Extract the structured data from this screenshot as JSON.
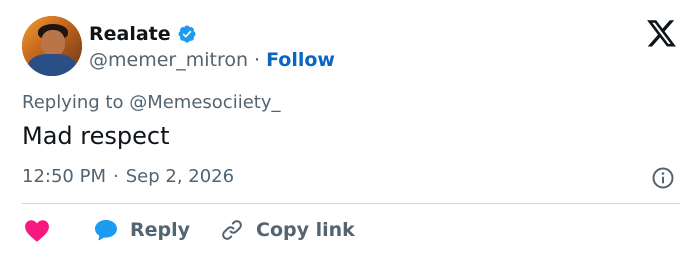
{
  "author": {
    "display_name": "Realate",
    "handle": "@memer_mitron",
    "separator": "·",
    "follow_label": "Follow"
  },
  "reply_context": {
    "prefix": "Replying to ",
    "mention": "@Memesociiety_"
  },
  "tweet": {
    "text": "Mad respect",
    "time": "12:50 PM",
    "separator": "·",
    "date": "Sep 2, 2026"
  },
  "actions": {
    "reply_label": "Reply",
    "copy_link_label": "Copy link"
  },
  "icons": {
    "verified": "verified-badge-icon",
    "x_logo": "x-logo-icon",
    "info": "info-icon",
    "like": "heart-icon",
    "reply": "speech-bubble-icon",
    "copy": "link-icon"
  },
  "colors": {
    "link_blue": "#0a66c2",
    "verified_blue": "#1d9bf0",
    "heart_pink": "#f91880",
    "muted_text": "#536471",
    "primary_text": "#0f1419",
    "divider": "#cfd9de"
  }
}
